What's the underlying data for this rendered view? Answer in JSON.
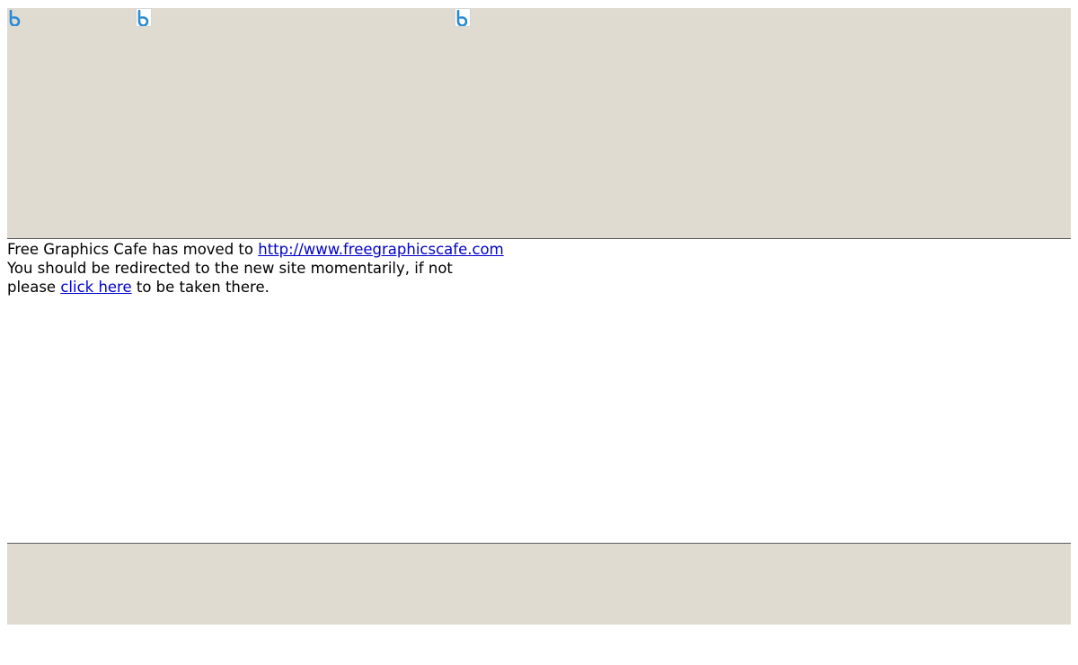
{
  "header": {
    "images": [
      {
        "icon": "broken-image-icon",
        "color": "#2a8ad6"
      },
      {
        "icon": "broken-image-icon",
        "color": "#2a8ad6"
      },
      {
        "icon": "broken-image-icon",
        "color": "#2a8ad6"
      }
    ],
    "background": "#dfdbd0"
  },
  "message": {
    "line1_prefix": "Free Graphics Cafe has moved to ",
    "new_site_link": "http://www.freegraphicscafe.com",
    "line2": "You should be redirected to the new site momentarily, if not",
    "line3_prefix": "please ",
    "click_here_link": "click here",
    "line3_suffix": " to be taken there.",
    "link_color": "#0000cc"
  },
  "footer": {
    "background": "#dfdbd0"
  }
}
